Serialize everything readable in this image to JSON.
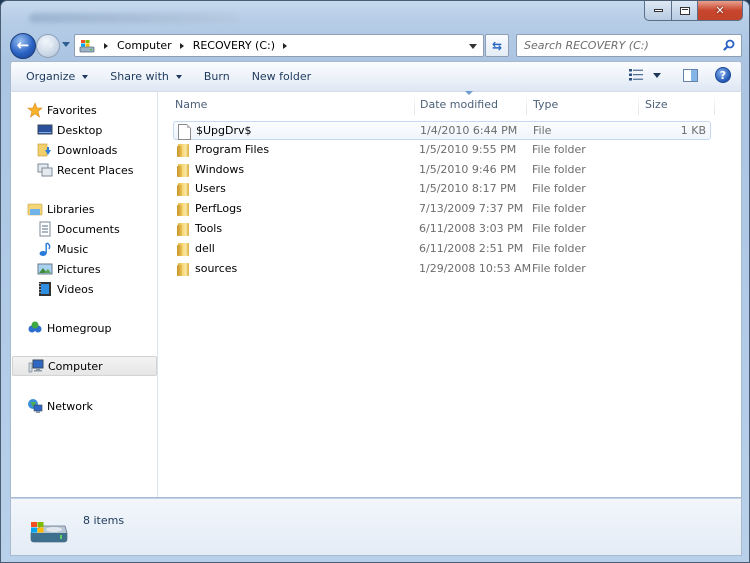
{
  "window": {
    "controls": {
      "minimize": "minimize",
      "maximize": "maximize",
      "close": "close"
    }
  },
  "nav": {
    "breadcrumb": [
      "Computer",
      "RECOVERY (C:)"
    ],
    "search_placeholder": "Search RECOVERY (C:)"
  },
  "toolbar": {
    "organize": "Organize",
    "share_with": "Share with",
    "burn": "Burn",
    "new_folder": "New folder"
  },
  "sidebar": {
    "favorites": {
      "label": "Favorites",
      "items": [
        "Desktop",
        "Downloads",
        "Recent Places"
      ]
    },
    "libraries": {
      "label": "Libraries",
      "items": [
        "Documents",
        "Music",
        "Pictures",
        "Videos"
      ]
    },
    "homegroup": "Homegroup",
    "computer": "Computer",
    "network": "Network",
    "selected": "Computer"
  },
  "columns": {
    "name": "Name",
    "date": "Date modified",
    "type": "Type",
    "size": "Size",
    "sorted_by": "Date modified"
  },
  "files": [
    {
      "name": "$UpgDrv$",
      "date": "1/4/2010 6:44 PM",
      "type": "File",
      "size": "1 KB",
      "icon": "file-icon"
    },
    {
      "name": "Program Files",
      "date": "1/5/2010 9:55 PM",
      "type": "File folder",
      "size": "",
      "icon": "folder-icon"
    },
    {
      "name": "Windows",
      "date": "1/5/2010 9:46 PM",
      "type": "File folder",
      "size": "",
      "icon": "folder-icon"
    },
    {
      "name": "Users",
      "date": "1/5/2010 8:17 PM",
      "type": "File folder",
      "size": "",
      "icon": "folder-icon"
    },
    {
      "name": "PerfLogs",
      "date": "7/13/2009 7:37 PM",
      "type": "File folder",
      "size": "",
      "icon": "folder-icon"
    },
    {
      "name": "Tools",
      "date": "6/11/2008 3:03 PM",
      "type": "File folder",
      "size": "",
      "icon": "folder-icon"
    },
    {
      "name": "dell",
      "date": "6/11/2008 2:51 PM",
      "type": "File folder",
      "size": "",
      "icon": "folder-icon"
    },
    {
      "name": "sources",
      "date": "1/29/2008 10:53 AM",
      "type": "File folder",
      "size": "",
      "icon": "folder-icon"
    }
  ],
  "status": {
    "item_count": "8 items"
  }
}
